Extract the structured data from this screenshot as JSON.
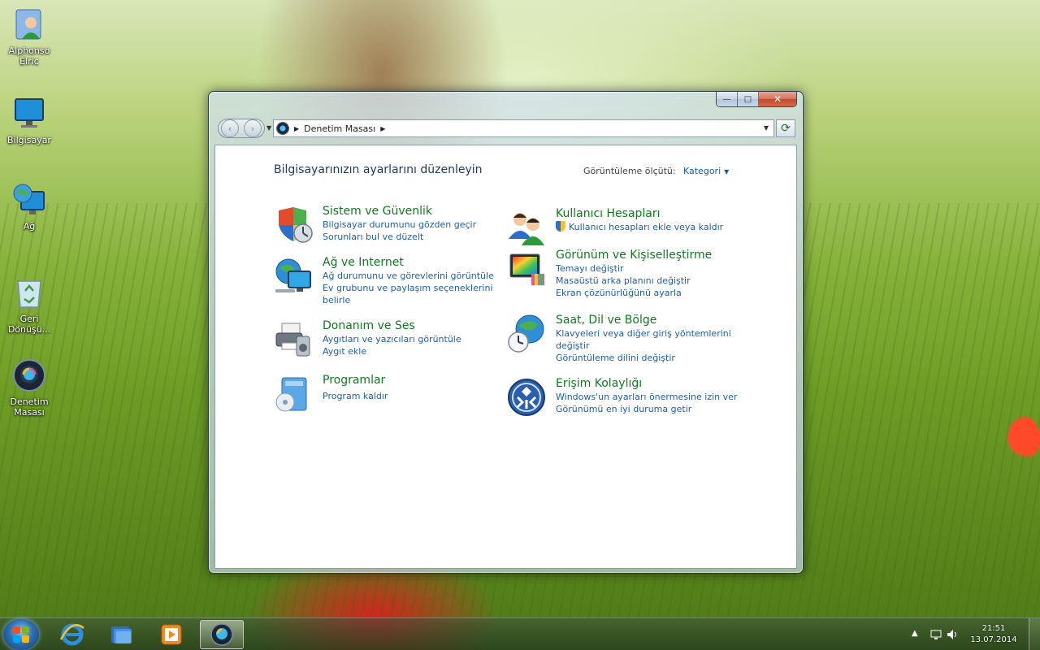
{
  "desktop": {
    "icons": [
      {
        "label": "Alphonso Elric"
      },
      {
        "label": "Bilgisayar"
      },
      {
        "label": "Ağ"
      },
      {
        "label": "Geri Dönüşü..."
      },
      {
        "label": "Denetim Masası"
      }
    ]
  },
  "window": {
    "caption": {
      "minimize": "—",
      "maximize": "□",
      "close": "✕"
    },
    "nav": {
      "back": "‹",
      "forward": "›"
    },
    "address": {
      "crumb": "Denetim Masası"
    },
    "content": {
      "heading": "Bilgisayarınızın ayarlarını düzenleyin",
      "view_by_label": "Görüntüleme ölçütü:",
      "view_by_value": "Kategori",
      "categories": [
        {
          "title": "Sistem ve Güvenlik",
          "links": [
            "Bilgisayar durumunu gözden geçir",
            "Sorunları bul ve düzelt"
          ],
          "icon": "shield-icon"
        },
        {
          "title": "Ağ ve Internet",
          "links": [
            "Ağ durumunu ve görevlerini görüntüle",
            "Ev grubunu ve paylaşım seçeneklerini",
            "belirle"
          ],
          "icon": "network-globe-icon"
        },
        {
          "title": "Donanım ve Ses",
          "links": [
            "Aygıtları ve yazıcıları görüntüle",
            "Aygıt ekle"
          ],
          "icon": "printer-speaker-icon"
        },
        {
          "title": "Programlar",
          "links": [
            "Program kaldır"
          ],
          "icon": "programs-disc-icon"
        },
        {
          "title": "Kullanıcı Hesapları",
          "links": [
            "Kullanıcı hesapları ekle veya kaldır"
          ],
          "icon": "users-icon"
        },
        {
          "title": "Görünüm ve Kişiselleştirme",
          "links": [
            "Temayı değiştir",
            "Masaüstü arka planını değiştir",
            "Ekran çözünürlüğünü ayarla"
          ],
          "icon": "appearance-icon"
        },
        {
          "title": "Saat, Dil ve Bölge",
          "links": [
            "Klavyeleri veya diğer giriş yöntemlerini",
            "değiştir",
            "Görüntüleme dilini değiştir"
          ],
          "icon": "clock-globe-icon"
        },
        {
          "title": "Erişim Kolaylığı",
          "links": [
            "Windows'un ayarları önermesine izin ver",
            "Görünümü en iyi duruma getir"
          ],
          "icon": "ease-of-access-icon"
        }
      ]
    }
  },
  "taskbar": {
    "clock_time": "21:51",
    "clock_date": "13.07.2014",
    "tray_expand": "▲"
  },
  "colors": {
    "category_title": "#0f7a1f",
    "link": "#1c5fb0",
    "heading": "#1e395b"
  }
}
